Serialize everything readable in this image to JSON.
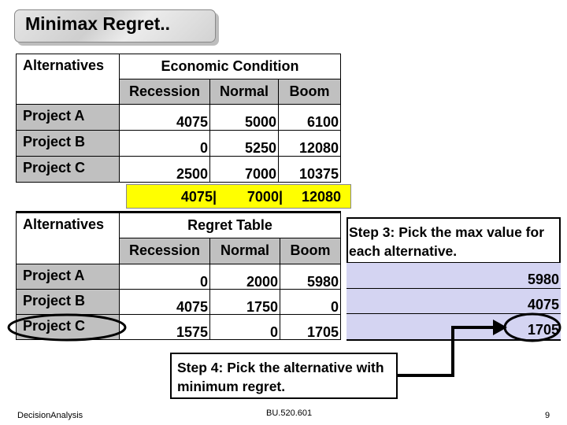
{
  "title": "Minimax Regret..",
  "table1": {
    "corner": "Alternatives",
    "group": "Economic Condition",
    "columns": [
      "Recession",
      "Normal",
      "Boom"
    ],
    "rows": [
      {
        "label": "Project  A",
        "values": [
          "4075",
          "5000",
          "6100"
        ]
      },
      {
        "label": "Project  B",
        "values": [
          "0",
          "5250",
          "12080"
        ]
      },
      {
        "label": "Project  C",
        "values": [
          "2500",
          "7000",
          "10375"
        ]
      }
    ],
    "max_row": [
      "4075|",
      "7000|",
      "12080"
    ],
    "max_row_color": "#ffff00"
  },
  "table2": {
    "corner": "Alternatives",
    "group": "Regret Table",
    "columns": [
      "Recession",
      "Normal",
      "Boom"
    ],
    "rows": [
      {
        "label": "Project  A",
        "values": [
          "0",
          "2000",
          "5980"
        ]
      },
      {
        "label": "Project  B",
        "values": [
          "4075",
          "1750",
          "0"
        ]
      },
      {
        "label": "Project  C",
        "values": [
          "1575",
          "0",
          "1705"
        ]
      }
    ]
  },
  "step3": {
    "text": "Step 3: Pick the max value for each alternative.",
    "values": [
      "5980",
      "4075",
      "1705"
    ],
    "color": "#d4d4f2"
  },
  "step4": {
    "text": "Step 4: Pick the alternative with minimum regret."
  },
  "footer": {
    "left": "DecisionAnalysis",
    "center": "BU.520.601",
    "page": "9"
  }
}
